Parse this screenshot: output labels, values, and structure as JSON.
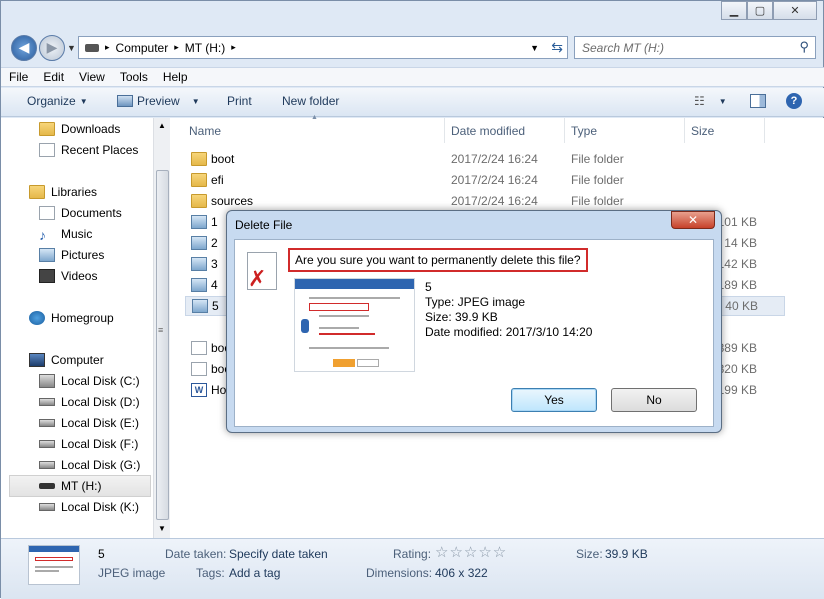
{
  "address": {
    "crumbs": [
      "Computer",
      "MT (H:)"
    ],
    "search_placeholder": "Search MT (H:)"
  },
  "menu": [
    "File",
    "Edit",
    "View",
    "Tools",
    "Help"
  ],
  "toolbar": {
    "organize": "Organize",
    "preview": "Preview",
    "print": "Print",
    "new_folder": "New folder"
  },
  "nav": {
    "downloads": "Downloads",
    "recent": "Recent Places",
    "libraries": "Libraries",
    "documents": "Documents",
    "music": "Music",
    "pictures": "Pictures",
    "videos": "Videos",
    "homegroup": "Homegroup",
    "computer": "Computer",
    "drives": [
      "Local Disk (C:)",
      "Local Disk (D:)",
      "Local Disk (E:)",
      "Local Disk (F:)",
      "Local Disk (G:)",
      "MT (H:)",
      "Local Disk (K:)"
    ]
  },
  "columns": {
    "name": "Name",
    "date": "Date modified",
    "type": "Type",
    "size": "Size"
  },
  "files": [
    {
      "name": "boot",
      "date": "2017/2/24 16:24",
      "type": "File folder",
      "size": ""
    },
    {
      "name": "efi",
      "date": "2017/2/24 16:24",
      "type": "File folder",
      "size": ""
    },
    {
      "name": "sources",
      "date": "2017/2/24 16:24",
      "type": "File folder",
      "size": ""
    },
    {
      "name": "1",
      "date": "",
      "type": "",
      "size": "101 KB"
    },
    {
      "name": "2",
      "date": "",
      "type": "",
      "size": "14 KB"
    },
    {
      "name": "3",
      "date": "",
      "type": "",
      "size": "142 KB"
    },
    {
      "name": "4",
      "date": "",
      "type": "",
      "size": "189 KB"
    },
    {
      "name": "5",
      "date": "",
      "type": "",
      "size": "40 KB"
    },
    {
      "name": "boo",
      "date": "",
      "type": "",
      "size": "389 KB"
    },
    {
      "name": "boo",
      "date": "",
      "type": "",
      "size": "320 KB"
    },
    {
      "name": "Ho",
      "date": "",
      "type": "",
      "size": "199 KB"
    }
  ],
  "details": {
    "name": "5",
    "kind": "JPEG image",
    "date_taken_label": "Date taken:",
    "date_taken": "Specify date taken",
    "tags_label": "Tags:",
    "tags": "Add a tag",
    "rating_label": "Rating:",
    "rating_stars": "☆☆☆☆☆",
    "dimensions_label": "Dimensions:",
    "dimensions": "406 x 322",
    "size_label": "Size:",
    "size": "39.9 KB"
  },
  "dialog": {
    "title": "Delete File",
    "question": "Are you sure you want to permanently delete this file?",
    "file_name": "5",
    "file_type": "Type: JPEG image",
    "file_size": "Size: 39.9 KB",
    "file_date": "Date modified: 2017/3/10 14:20",
    "yes": "Yes",
    "no": "No"
  }
}
